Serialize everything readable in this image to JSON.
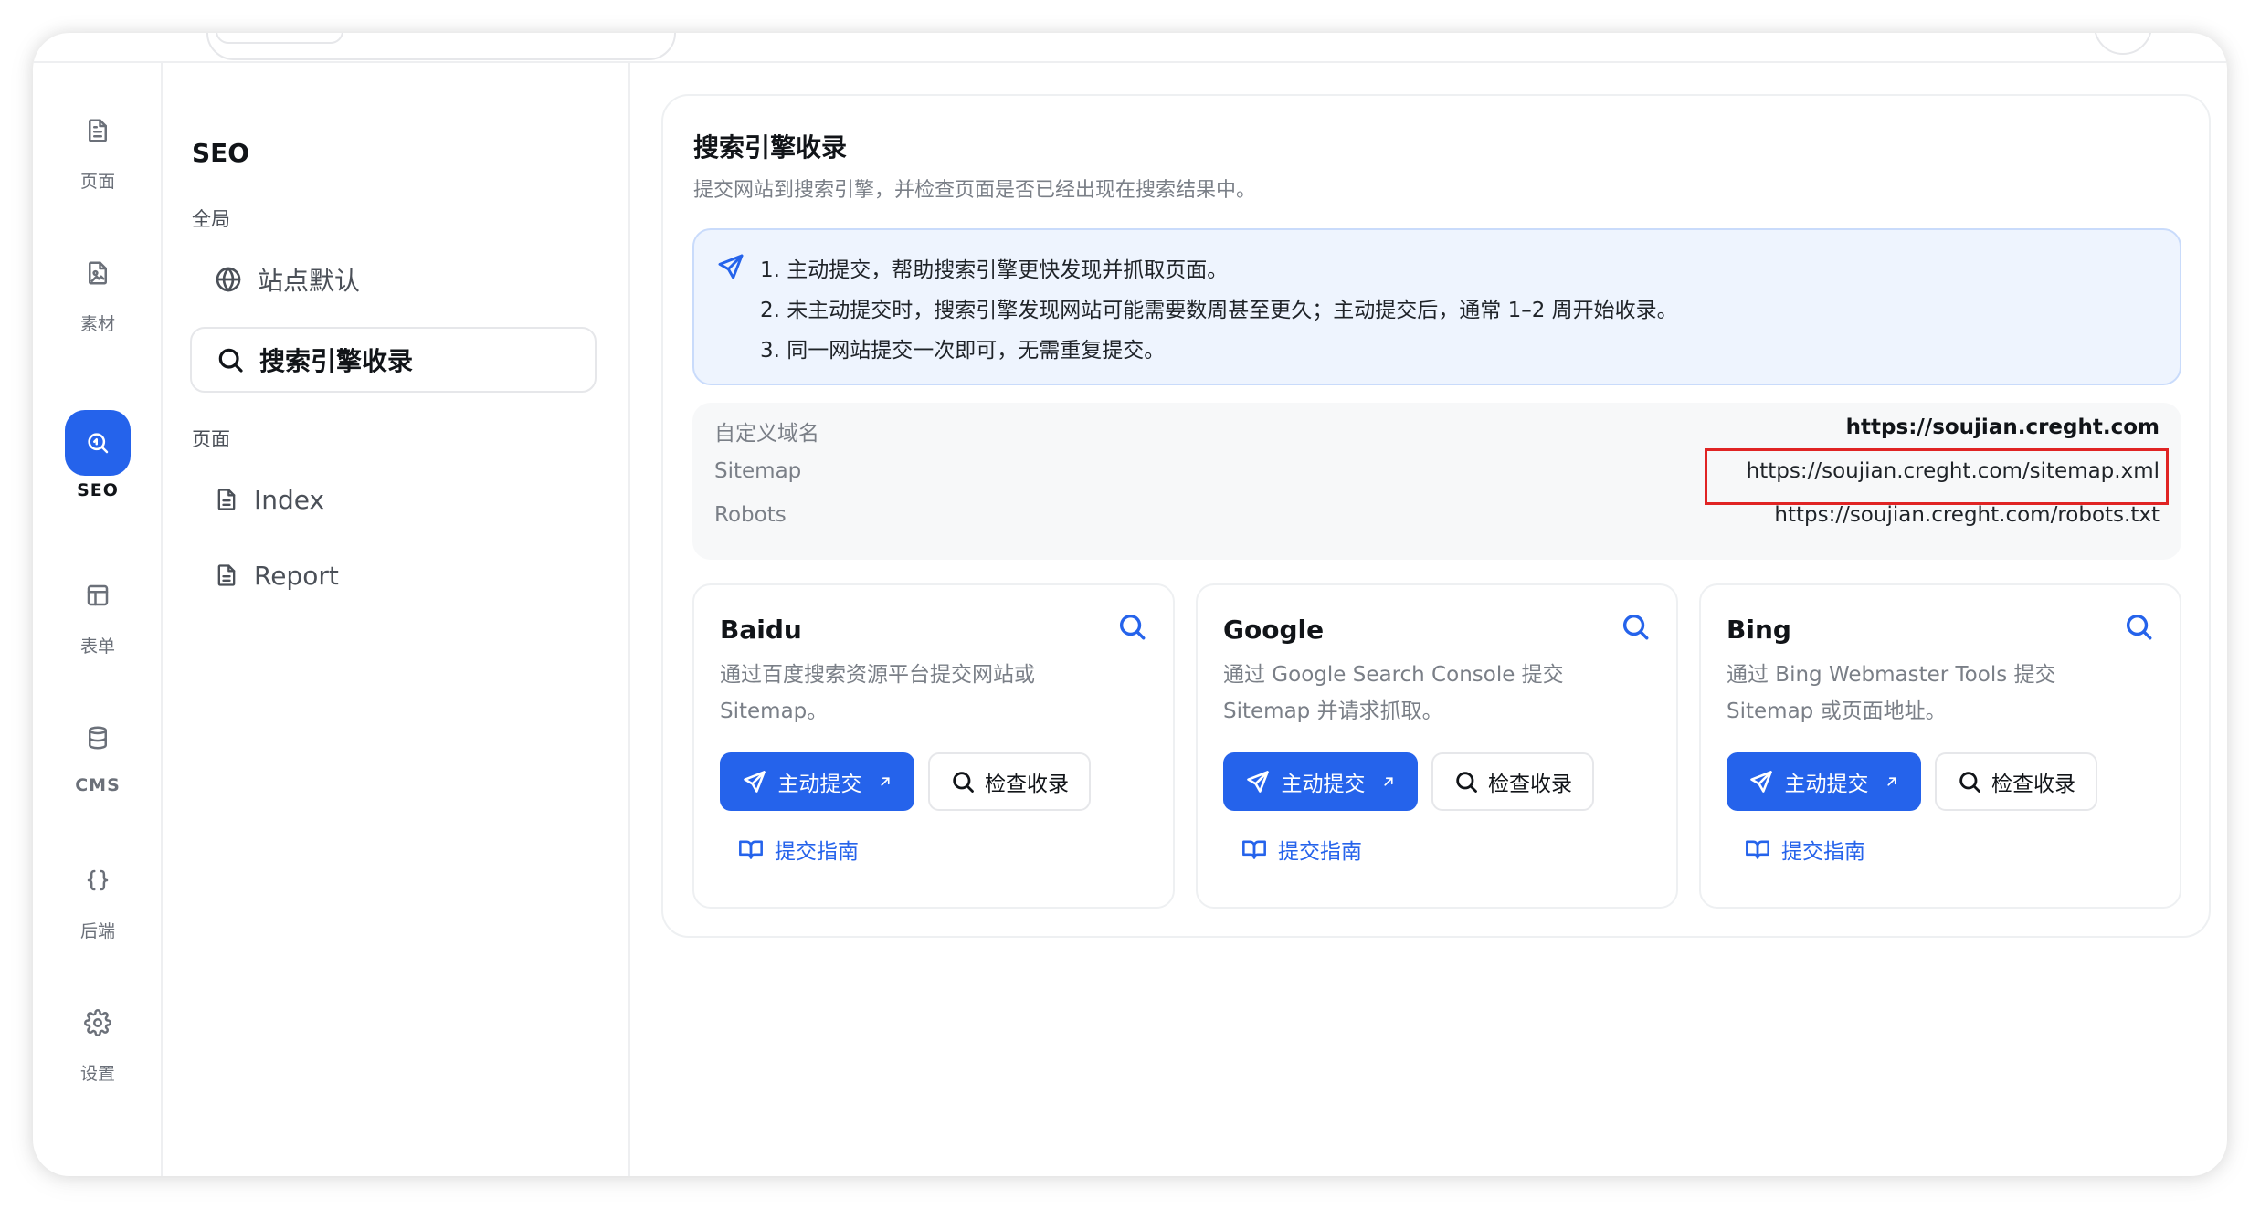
{
  "rail": [
    {
      "label": "页面",
      "icon": "file-icon"
    },
    {
      "label": "素材",
      "icon": "image-file-icon"
    },
    {
      "label": "SEO",
      "icon": "search-zoom-icon",
      "active": true
    },
    {
      "label": "表单",
      "icon": "layout-icon"
    },
    {
      "label": "CMS",
      "icon": "database-icon"
    },
    {
      "label": "后端",
      "icon": "braces-icon"
    },
    {
      "label": "设置",
      "icon": "gear-icon"
    }
  ],
  "sidebar": {
    "title": "SEO",
    "section_global": "全局",
    "item_site_defaults": "站点默认",
    "item_search_indexing": "搜索引擎收录",
    "section_pages": "页面",
    "page_index": "Index",
    "page_report": "Report"
  },
  "main": {
    "title": "搜索引擎收录",
    "subtitle": "提交网站到搜索引擎，并检查页面是否已经出现在搜索结果中。",
    "notice": [
      "1. 主动提交，帮助搜索引擎更快发现并抓取页面。",
      "2. 未主动提交时，搜索引擎发现网站可能需要数周甚至更久；主动提交后，通常 1–2 周开始收录。",
      "3. 同一网站提交一次即可，无需重复提交。"
    ],
    "kv": {
      "domain_key": "自定义域名",
      "domain_val": "https://soujian.creght.com",
      "sitemap_key": "Sitemap",
      "sitemap_val": "https://soujian.creght.com/sitemap.xml",
      "robots_key": "Robots",
      "robots_val": "https://soujian.creght.com/robots.txt"
    },
    "engines": [
      {
        "name": "Baidu",
        "desc": "通过百度搜索资源平台提交网站或 Sitemap。",
        "submit": "主动提交",
        "check": "检查收录",
        "guide": "提交指南"
      },
      {
        "name": "Google",
        "desc": "通过 Google Search Console 提交 Sitemap 并请求抓取。",
        "submit": "主动提交",
        "check": "检查收录",
        "guide": "提交指南"
      },
      {
        "name": "Bing",
        "desc": "通过 Bing Webmaster Tools 提交 Sitemap 或页面地址。",
        "submit": "主动提交",
        "check": "检查收录",
        "guide": "提交指南"
      }
    ]
  },
  "colors": {
    "accent": "#2563eb",
    "notice_bg": "#eef4fe",
    "highlight": "#e02424"
  }
}
